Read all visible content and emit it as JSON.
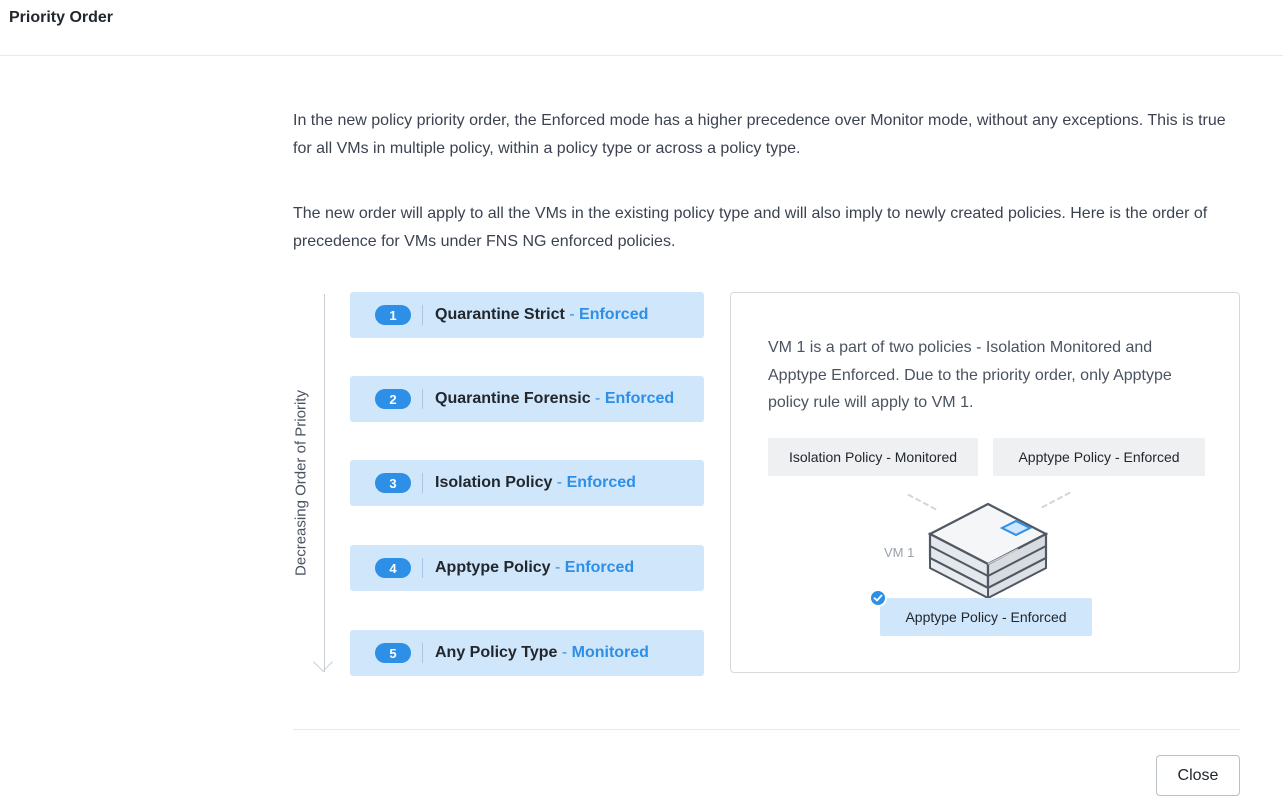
{
  "header": {
    "title": "Priority Order"
  },
  "intro": {
    "p1": "In the new policy priority order, the Enforced mode has a higher precedence over Monitor mode, without any exceptions. This is true for all VMs in multiple policy, within a policy type or across a policy type.",
    "p2": "The new order will apply to all the VMs in the existing policy type and will also imply to newly created policies. Here is the order of precedence for VMs under FNS NG enforced policies."
  },
  "axis": {
    "label": "Decreasing Order of Priority"
  },
  "priority": {
    "items": [
      {
        "num": "1",
        "name": "Quarantine Strict",
        "sep": " - ",
        "mode": "Enforced"
      },
      {
        "num": "2",
        "name": "Quarantine Forensic",
        "sep": " - ",
        "mode": "Enforced"
      },
      {
        "num": "3",
        "name": "Isolation Policy",
        "sep": " - ",
        "mode": "Enforced"
      },
      {
        "num": "4",
        "name": "Apptype Policy",
        "sep": " - ",
        "mode": "Enforced"
      },
      {
        "num": "5",
        "name": "Any Policy Type",
        "sep": " - ",
        "mode": "Monitored"
      }
    ]
  },
  "example": {
    "text": "VM 1 is a part of two policies - Isolation Monitored and Apptype Enforced. Due to the priority order, only Apptype policy rule will apply to VM 1.",
    "chip1": "Isolation Policy - Monitored",
    "chip2": "Apptype Policy - Enforced",
    "vm_label": "VM 1",
    "result": "Apptype Policy - Enforced"
  },
  "footer": {
    "close_label": "Close"
  },
  "colors": {
    "accent": "#2d8fe6",
    "item_bg": "#cfe6fb",
    "chip_bg": "#eef0f2"
  }
}
